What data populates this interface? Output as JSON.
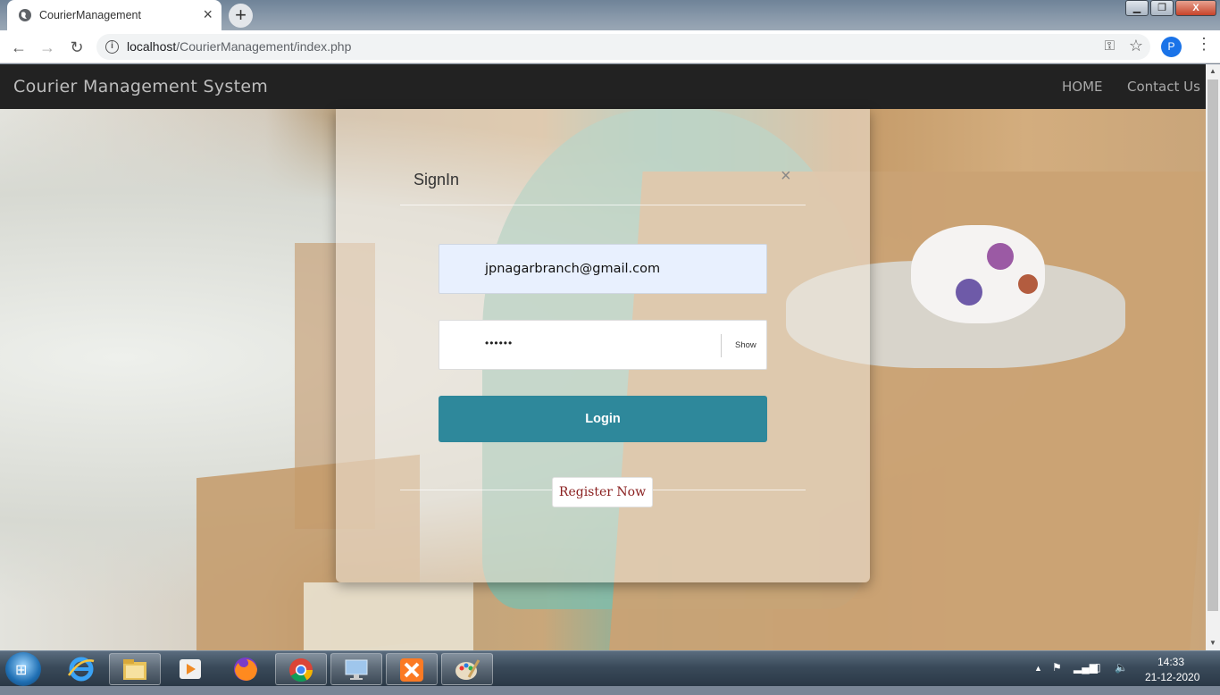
{
  "browser": {
    "tab_title": "CourierManagement",
    "new_tab": "+",
    "tab_close": "×",
    "url_host": "localhost",
    "url_path": "/CourierManagement/index.php",
    "profile_initial": "P",
    "window_buttons": {
      "minimize": "▁",
      "maximize": "❐",
      "close": "X"
    }
  },
  "navbar": {
    "brand": "Courier Management System",
    "links": [
      "HOME",
      "Contact Us"
    ]
  },
  "signin": {
    "title": "SignIn",
    "close": "×",
    "email_value": "jpnagarbranch@gmail.com",
    "password_mask": "••••••",
    "show_label": "Show",
    "login_label": "Login",
    "register_label": "Register Now"
  },
  "taskbar": {
    "time": "14:33",
    "date": "21-12-2020"
  },
  "colors": {
    "navbar_bg": "#222222",
    "login_button": "#2e889b",
    "register_text": "#8a2020",
    "email_autofill_bg": "#e8f0fe"
  },
  "icons": {
    "back": "back-arrow-icon",
    "forward": "forward-arrow-icon",
    "reload": "reload-icon",
    "site_info": "info-icon",
    "password_key": "key-icon",
    "bookmark": "star-icon",
    "menu": "vertical-dots-icon"
  }
}
